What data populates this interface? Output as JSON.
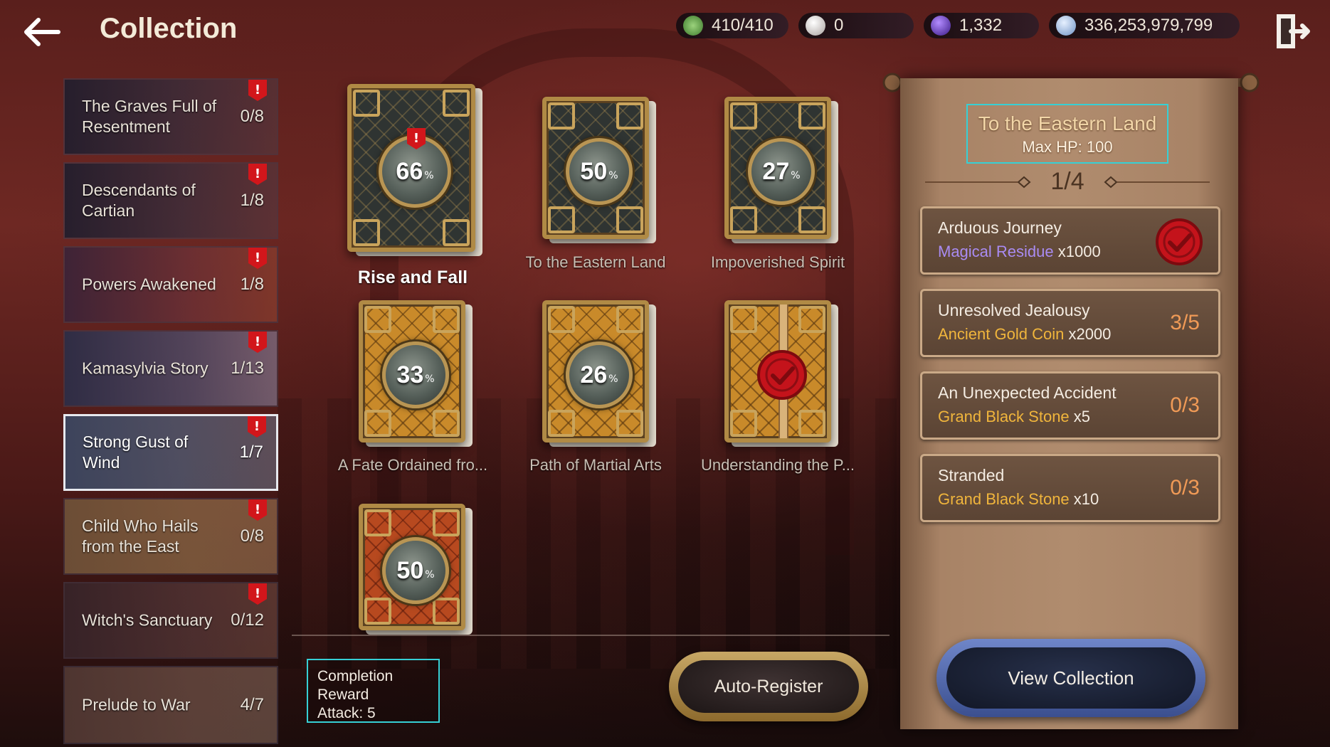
{
  "header": {
    "title": "Collection",
    "currencies": [
      {
        "icon": "energy-icon",
        "value": "410/410",
        "color": "#6fb35a"
      },
      {
        "icon": "pearl-icon",
        "value": "0",
        "color": "#d8d4d2"
      },
      {
        "icon": "crystal-icon",
        "value": "1,332",
        "color": "#6a3cc9"
      },
      {
        "icon": "silver-coin-icon",
        "value": "336,253,979,799",
        "color": "#7fa7d8"
      }
    ]
  },
  "sidebar": {
    "items": [
      {
        "name": "The Graves Full of Resentment",
        "count": "0/8"
      },
      {
        "name": "Descendants of Cartian",
        "count": "1/8"
      },
      {
        "name": "Powers Awakened",
        "count": "1/8"
      },
      {
        "name": "Kamasylvia Story",
        "count": "1/13"
      },
      {
        "name": "Strong Gust of Wind",
        "count": "1/7"
      },
      {
        "name": "Child Who Hails from the East",
        "count": "0/8"
      },
      {
        "name": "Witch's Sanctuary",
        "count": "0/12"
      },
      {
        "name": "Prelude to War",
        "count": "4/7"
      }
    ]
  },
  "cards": [
    {
      "label": "Rise and Fall",
      "percent": "66",
      "style": "dark"
    },
    {
      "label": "To the Eastern Land",
      "percent": "50",
      "style": "dark"
    },
    {
      "label": "Impoverished Spirit",
      "percent": "27",
      "style": "dark"
    },
    {
      "label": "A Fate Ordained fro...",
      "percent": "33",
      "style": "gold"
    },
    {
      "label": "Path of Martial Arts",
      "percent": "26",
      "style": "gold"
    },
    {
      "label": "Understanding the P...",
      "percent": "",
      "style": "gold"
    },
    {
      "label": "",
      "percent": "50",
      "style": "red"
    }
  ],
  "percent_sign": "%",
  "completion": {
    "title": "Completion Reward",
    "value": "Attack: 5"
  },
  "auto_register": "Auto-Register",
  "panel": {
    "title": "To the Eastern Land",
    "subtitle": "Max HP: 100",
    "page": "1/4",
    "tasks": [
      {
        "name": "Arduous Journey",
        "item": "Magical Residue",
        "qty": "x1000",
        "progress": ""
      },
      {
        "name": "Unresolved Jealousy",
        "item": "Ancient Gold Coin",
        "qty": "x2000",
        "progress": "3/5"
      },
      {
        "name": "An Unexpected Accident",
        "item": "Grand Black Stone",
        "qty": "x5",
        "progress": "0/3"
      },
      {
        "name": "Stranded",
        "item": "Grand Black Stone",
        "qty": "x10",
        "progress": "0/3"
      }
    ],
    "view_button": "View Collection"
  }
}
